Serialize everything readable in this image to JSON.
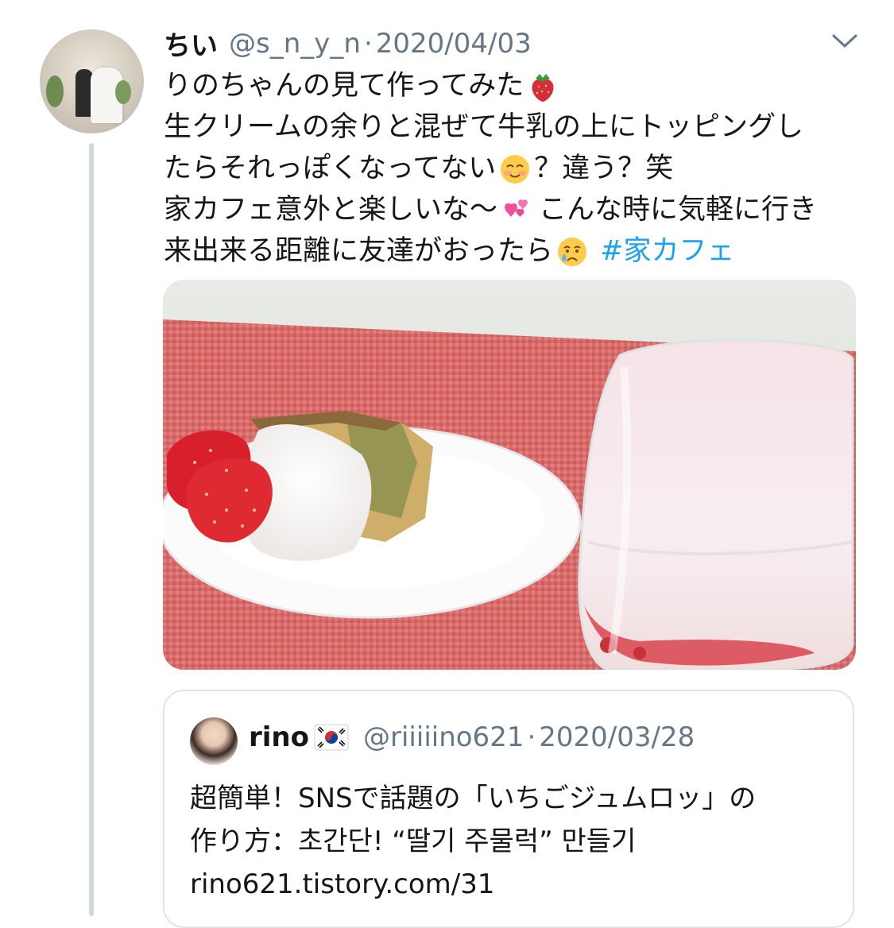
{
  "tweet": {
    "display_name": "ちい",
    "handle": "@s_n_y_n",
    "separator": "·",
    "date": "2020/04/03",
    "lines": [
      {
        "text": "りのちゃんの見て作ってみた",
        "emoji": "strawberry-emoji"
      },
      {
        "text": "生クリームの余りと混ぜて牛乳の上にトッピングし"
      },
      {
        "text_before": "たらそれっぽくなってない",
        "emoji": "smiling-face-emoji",
        "text_after": "？違う？笑"
      },
      {
        "text_before": "家カフェ意外と楽しいな〜",
        "emoji": "two-hearts-emoji",
        "text_after": "こんな時に気軽に行き"
      },
      {
        "text_before": "来出来る距離に友達がおったら",
        "emoji": "crying-face-emoji",
        "hashtag": "#家カフェ"
      }
    ],
    "menu_icon": "chevron-down-icon",
    "photo_alt": "strawberries, whipped cream, pound cake and strawberry milk in a glass"
  },
  "quote": {
    "display_name": "rino",
    "flag": "south-korea-flag-emoji",
    "handle": "@riiiiino621",
    "separator": "·",
    "date": "2020/03/28",
    "lines": [
      "超簡単！SNSで話題の「いちごジュムロッ」の",
      "作り方：초간단! “딸기 주물럭” 만들기",
      "rino621.tistory.com/31"
    ]
  },
  "colors": {
    "text": "#14171a",
    "secondary": "#657786",
    "link": "#1da1f2",
    "border": "#dfe5ea",
    "thread": "#cfd9de"
  }
}
